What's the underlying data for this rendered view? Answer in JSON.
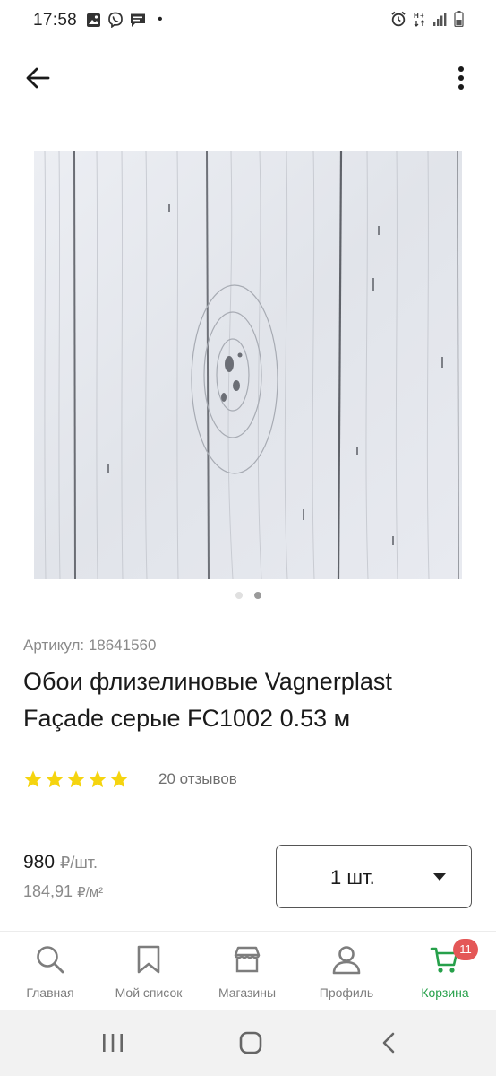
{
  "status_bar": {
    "time": "17:58",
    "dot": "•",
    "left_icons": [
      "image-icon",
      "viber-icon",
      "message-icon"
    ],
    "right_icons": [
      "alarm-icon",
      "network-icon",
      "signal-icon",
      "battery-icon"
    ]
  },
  "app_bar": {
    "back_icon": "arrow-left-icon",
    "more_icon": "more-vertical-icon"
  },
  "gallery": {
    "pages": 2,
    "active_page": 2
  },
  "product": {
    "sku_label": "Артикул: 18641560",
    "title": "Обои флизелиновые Vagnerplast Façade серые FC1002 0.53 м",
    "rating": 5,
    "reviews": "20 отзывов"
  },
  "price": {
    "main_value": "980",
    "main_unit": "₽/шт.",
    "area_value": "184,91",
    "area_unit": "₽/м²"
  },
  "quantity": {
    "selected": "1 шт."
  },
  "bottom_nav": {
    "items": [
      {
        "label": "Главная",
        "icon": "search-icon"
      },
      {
        "label": "Мой список",
        "icon": "bookmark-icon"
      },
      {
        "label": "Магазины",
        "icon": "store-icon"
      },
      {
        "label": "Профиль",
        "icon": "profile-icon"
      },
      {
        "label": "Корзина",
        "icon": "cart-icon"
      }
    ],
    "cart_badge": "11",
    "active_color": "#26a04a",
    "badge_color": "#e45757"
  },
  "system_nav": {
    "buttons": [
      "recent-apps-icon",
      "home-icon",
      "back-icon"
    ]
  },
  "colors": {
    "star": "#f5d40f",
    "accent": "#26a04a"
  }
}
